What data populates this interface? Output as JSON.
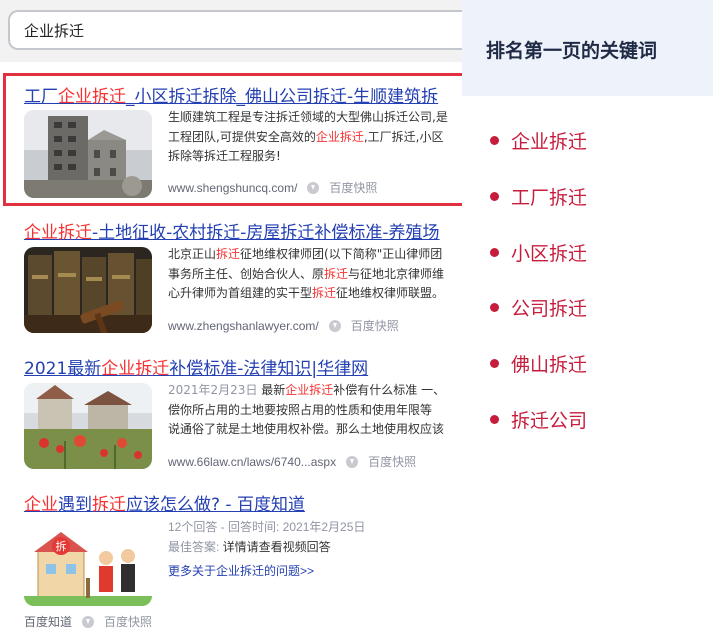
{
  "search": {
    "query": "企业拆迁"
  },
  "results": [
    {
      "title_parts": [
        {
          "t": "工厂",
          "hl": false
        },
        {
          "t": "企业拆迁",
          "hl": true
        },
        {
          "t": "_小区拆迁拆除_佛山公司拆迁-生顺建筑拆",
          "hl": false
        }
      ],
      "abstract_lines": [
        [
          {
            "t": "生顺建筑工程是专注拆迁领域的大型佛山拆迁公司,是",
            "hl": false
          }
        ],
        [
          {
            "t": "工程团队,可提供安全高效的",
            "hl": false
          },
          {
            "t": "企业拆迁",
            "hl": true
          },
          {
            "t": ",工厂拆迁,小区",
            "hl": false
          }
        ],
        [
          {
            "t": "拆除等拆迁工程服务!",
            "hl": false
          }
        ]
      ],
      "url": "www.shengshuncq.com/",
      "snapshot": "百度快照"
    },
    {
      "title_parts": [
        {
          "t": "企业拆迁",
          "hl": true
        },
        {
          "t": "-土地征收-农村拆迁-房屋拆迁补偿标准-养殖场",
          "hl": false
        }
      ],
      "abstract_lines": [
        [
          {
            "t": "北京正山",
            "hl": false
          },
          {
            "t": "拆迁",
            "hl": true
          },
          {
            "t": "征地维权律师团(以下简称\"正山律师团",
            "hl": false
          }
        ],
        [
          {
            "t": "事务所主任、创始合伙人、原",
            "hl": false
          },
          {
            "t": "拆迁",
            "hl": true
          },
          {
            "t": "与征地北京律师维",
            "hl": false
          }
        ],
        [
          {
            "t": "心升律师为首组建的实干型",
            "hl": false
          },
          {
            "t": "拆迁",
            "hl": true
          },
          {
            "t": "征地维权律师联盟。",
            "hl": false
          }
        ]
      ],
      "url": "www.zhengshanlawyer.com/",
      "snapshot": "百度快照"
    },
    {
      "title_parts": [
        {
          "t": "2021最新",
          "hl": false
        },
        {
          "t": "企业拆迁",
          "hl": true
        },
        {
          "t": "补偿标准-法律知识|华律网",
          "hl": false
        }
      ],
      "date": "2021年2月23日",
      "abstract_lines": [
        [
          {
            "t": " 最新",
            "hl": false
          },
          {
            "t": "企业拆迁",
            "hl": true
          },
          {
            "t": "补偿有什么标准 一、",
            "hl": false
          }
        ],
        [
          {
            "t": "偿你所占用的土地要按照占用的性质和使用年限等",
            "hl": false
          }
        ],
        [
          {
            "t": "说通俗了就是土地使用权补偿。那么土地使用权应该",
            "hl": false
          }
        ]
      ],
      "url": "www.66law.cn/laws/6740...aspx",
      "snapshot": "百度快照"
    },
    {
      "title_parts": [
        {
          "t": "企业",
          "hl": true
        },
        {
          "t": "遇到",
          "hl": false
        },
        {
          "t": "拆迁",
          "hl": true
        },
        {
          "t": "应该怎么做? - 百度知道",
          "hl": false
        }
      ],
      "meta_line": "12个回答 - 回答时间: 2021年2月25日",
      "best_answer_label": "最佳答案:",
      "best_answer": " 详情请查看视频回答",
      "more_link": "更多关于企业拆迁的问题>>",
      "source": "百度知道",
      "snapshot": "百度快照"
    }
  ],
  "panel": {
    "title": "排名第一页的关键词",
    "keywords": [
      "企业拆迁",
      "工厂拆迁",
      "小区拆迁",
      "公司拆迁",
      "佛山拆迁",
      "拆迁公司"
    ],
    "accent": "#c71d3c"
  }
}
